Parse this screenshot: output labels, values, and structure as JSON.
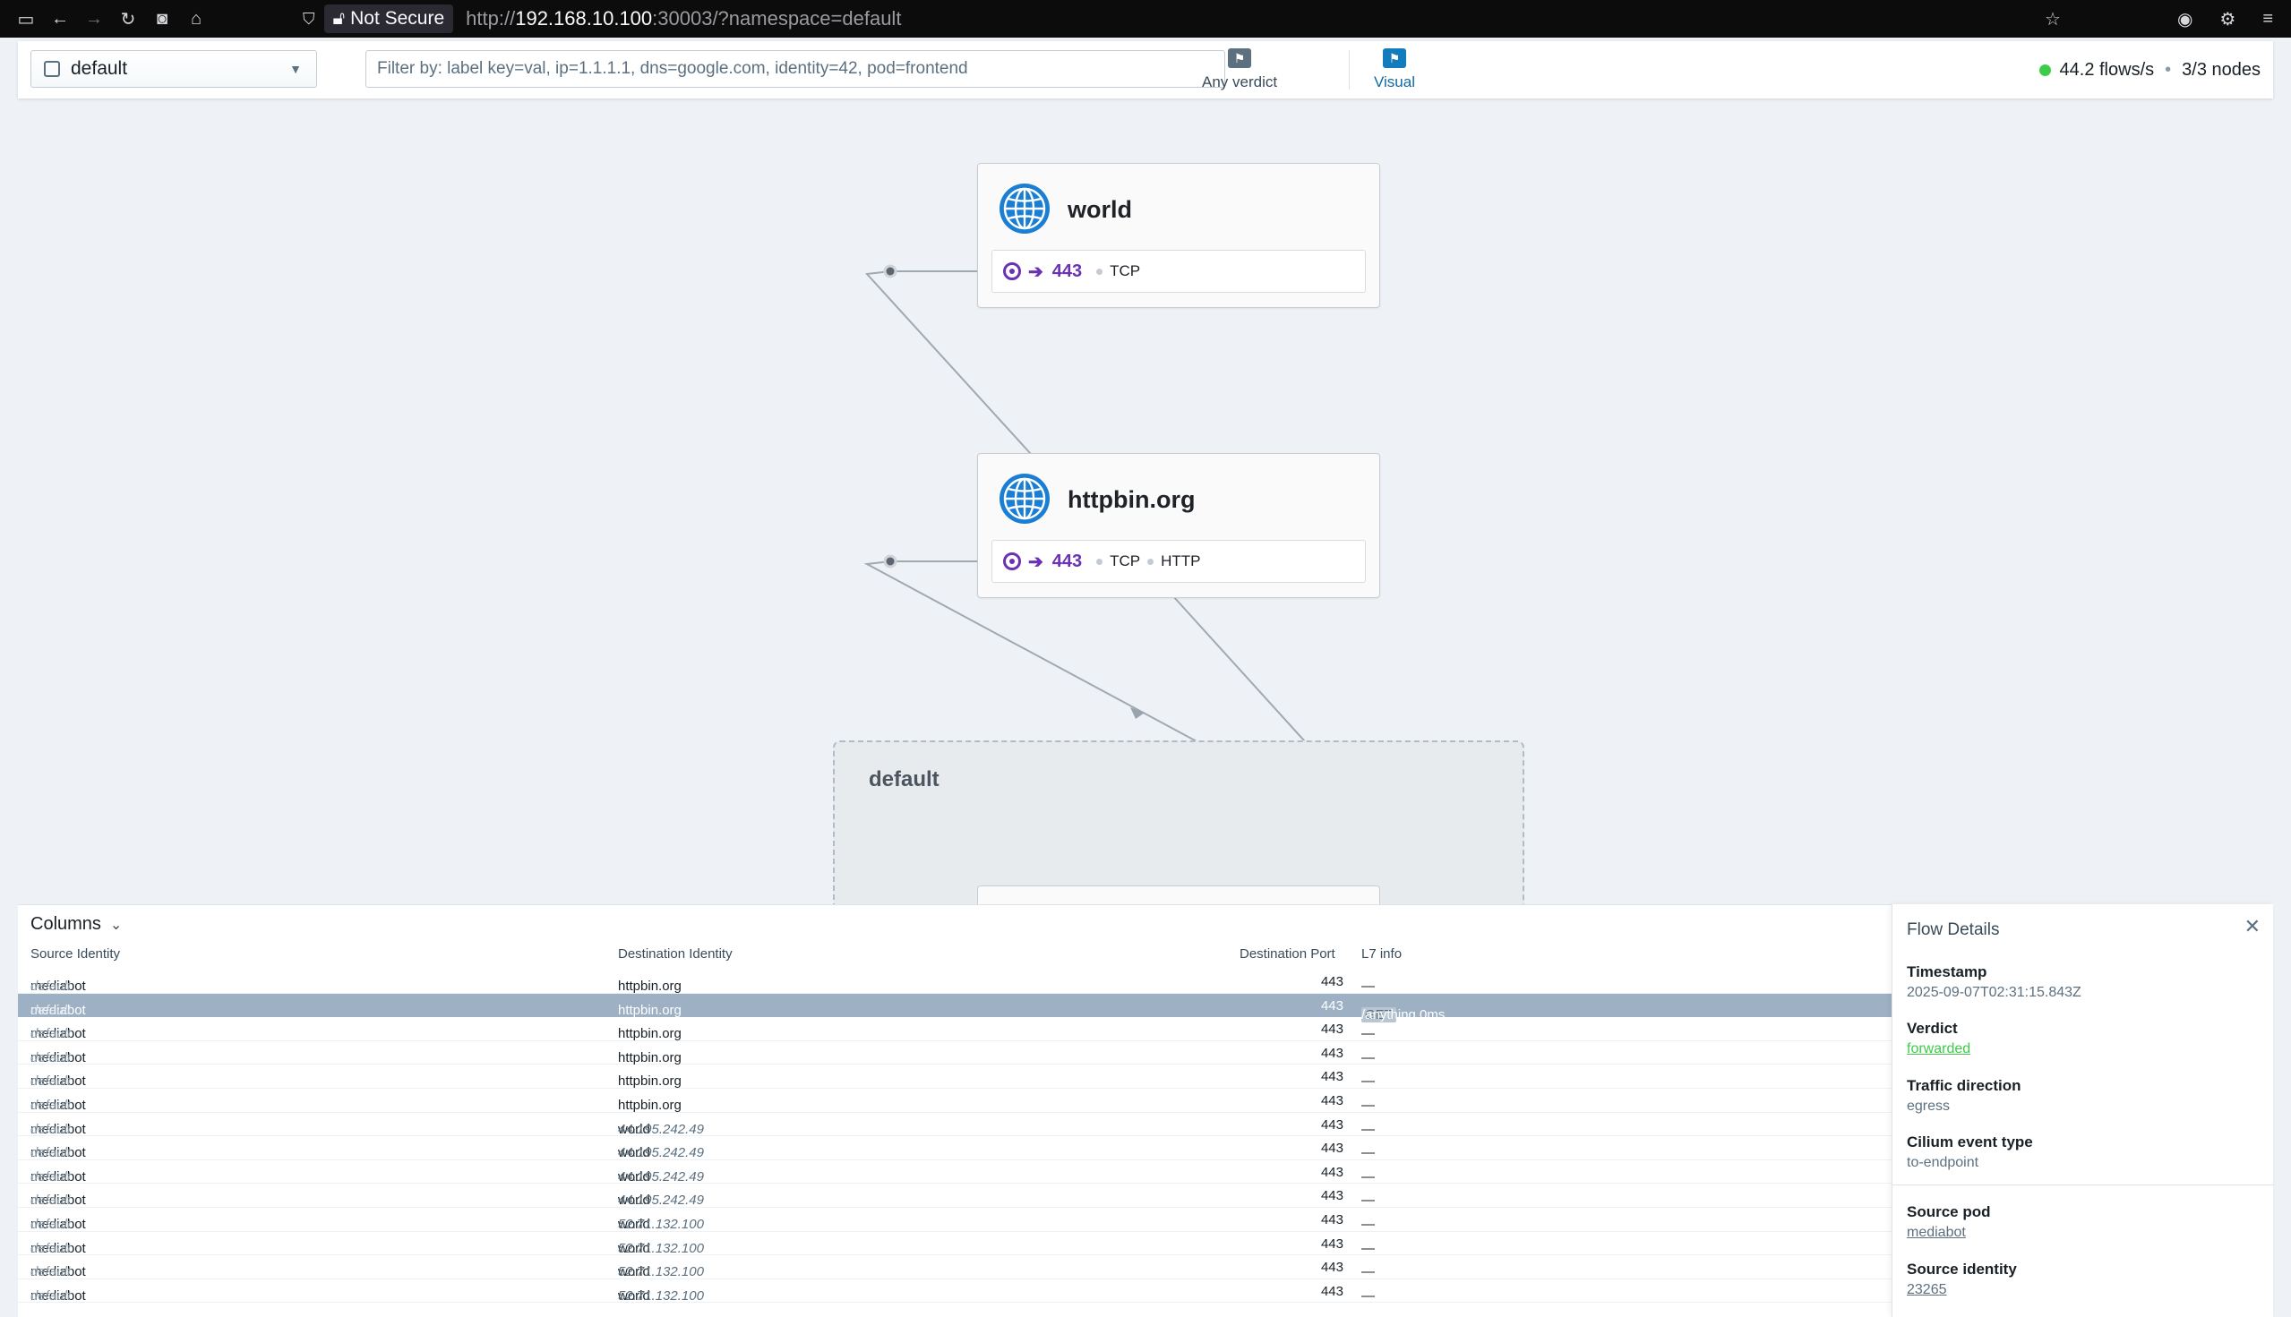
{
  "browser": {
    "not_secure": "Not Secure",
    "url_prefix": "http://",
    "url_host": "192.168.10.100",
    "url_rest": ":30003/?namespace=default"
  },
  "toolbar": {
    "namespace": "default",
    "filter_placeholder": "Filter by: label key=val, ip=1.1.1.1, dns=google.com, identity=42, pod=frontend",
    "verdict_label": "Any verdict",
    "visual_label": "Visual",
    "flows_rate": "44.2 flows/s",
    "nodes": "3/3 nodes"
  },
  "map": {
    "cards": [
      {
        "name": "world",
        "port": "443",
        "protocols": [
          "TCP"
        ]
      },
      {
        "name": "httpbin.org",
        "port": "443",
        "protocols": [
          "TCP",
          "HTTP"
        ]
      }
    ],
    "namespace_box": "default"
  },
  "flows": {
    "columns_label": "Columns",
    "headers": {
      "source": "Source Identity",
      "destination": "Destination Identity",
      "port": "Destination Port",
      "l7": "L7 info"
    },
    "rows": [
      {
        "src": "mediabot",
        "src_ns": "default",
        "dst": "httpbin.org",
        "dst_ip": "",
        "port": "443",
        "l7": "—"
      },
      {
        "src": "mediabot",
        "src_ns": "default",
        "dst": "httpbin.org",
        "dst_ip": "",
        "port": "443",
        "l7_arrow": "→",
        "l7_method": "GET",
        "l7": "/anything  0ms",
        "selected": true
      },
      {
        "src": "mediabot",
        "src_ns": "default",
        "dst": "httpbin.org",
        "dst_ip": "",
        "port": "443",
        "l7": "—"
      },
      {
        "src": "mediabot",
        "src_ns": "default",
        "dst": "httpbin.org",
        "dst_ip": "",
        "port": "443",
        "l7": "—"
      },
      {
        "src": "mediabot",
        "src_ns": "default",
        "dst": "httpbin.org",
        "dst_ip": "",
        "port": "443",
        "l7": "—"
      },
      {
        "src": "mediabot",
        "src_ns": "default",
        "dst": "httpbin.org",
        "dst_ip": "",
        "port": "443",
        "l7": "—"
      },
      {
        "src": "mediabot",
        "src_ns": "default",
        "dst": "world",
        "dst_ip": "44.195.242.49",
        "port": "443",
        "l7": "—"
      },
      {
        "src": "mediabot",
        "src_ns": "default",
        "dst": "world",
        "dst_ip": "44.195.242.49",
        "port": "443",
        "l7": "—"
      },
      {
        "src": "mediabot",
        "src_ns": "default",
        "dst": "world",
        "dst_ip": "44.195.242.49",
        "port": "443",
        "l7": "—"
      },
      {
        "src": "mediabot",
        "src_ns": "default",
        "dst": "world",
        "dst_ip": "44.195.242.49",
        "port": "443",
        "l7": "—"
      },
      {
        "src": "mediabot",
        "src_ns": "default",
        "dst": "world",
        "dst_ip": "52.71.132.100",
        "port": "443",
        "l7": "—"
      },
      {
        "src": "mediabot",
        "src_ns": "default",
        "dst": "world",
        "dst_ip": "52.71.132.100",
        "port": "443",
        "l7": "—"
      },
      {
        "src": "mediabot",
        "src_ns": "default",
        "dst": "world",
        "dst_ip": "52.71.132.100",
        "port": "443",
        "l7": "—"
      },
      {
        "src": "mediabot",
        "src_ns": "default",
        "dst": "world",
        "dst_ip": "52.71.132.100",
        "port": "443",
        "l7": "—"
      }
    ]
  },
  "details": {
    "title": "Flow Details",
    "timestamp_label": "Timestamp",
    "timestamp": "2025-09-07T02:31:15.843Z",
    "verdict_label": "Verdict",
    "verdict": "forwarded",
    "direction_label": "Traffic direction",
    "direction": "egress",
    "event_label": "Cilium event type",
    "event": "to-endpoint",
    "source_pod_label": "Source pod",
    "source_pod": "mediabot",
    "source_identity_label": "Source identity",
    "source_identity": "23265"
  },
  "colors": {
    "accent": "#137cbd",
    "endpoint_purple": "#6a31b5",
    "status_green": "#3dcc48",
    "globe_blue": "#1a7fd4",
    "selected_row": "#9eb0c4"
  }
}
